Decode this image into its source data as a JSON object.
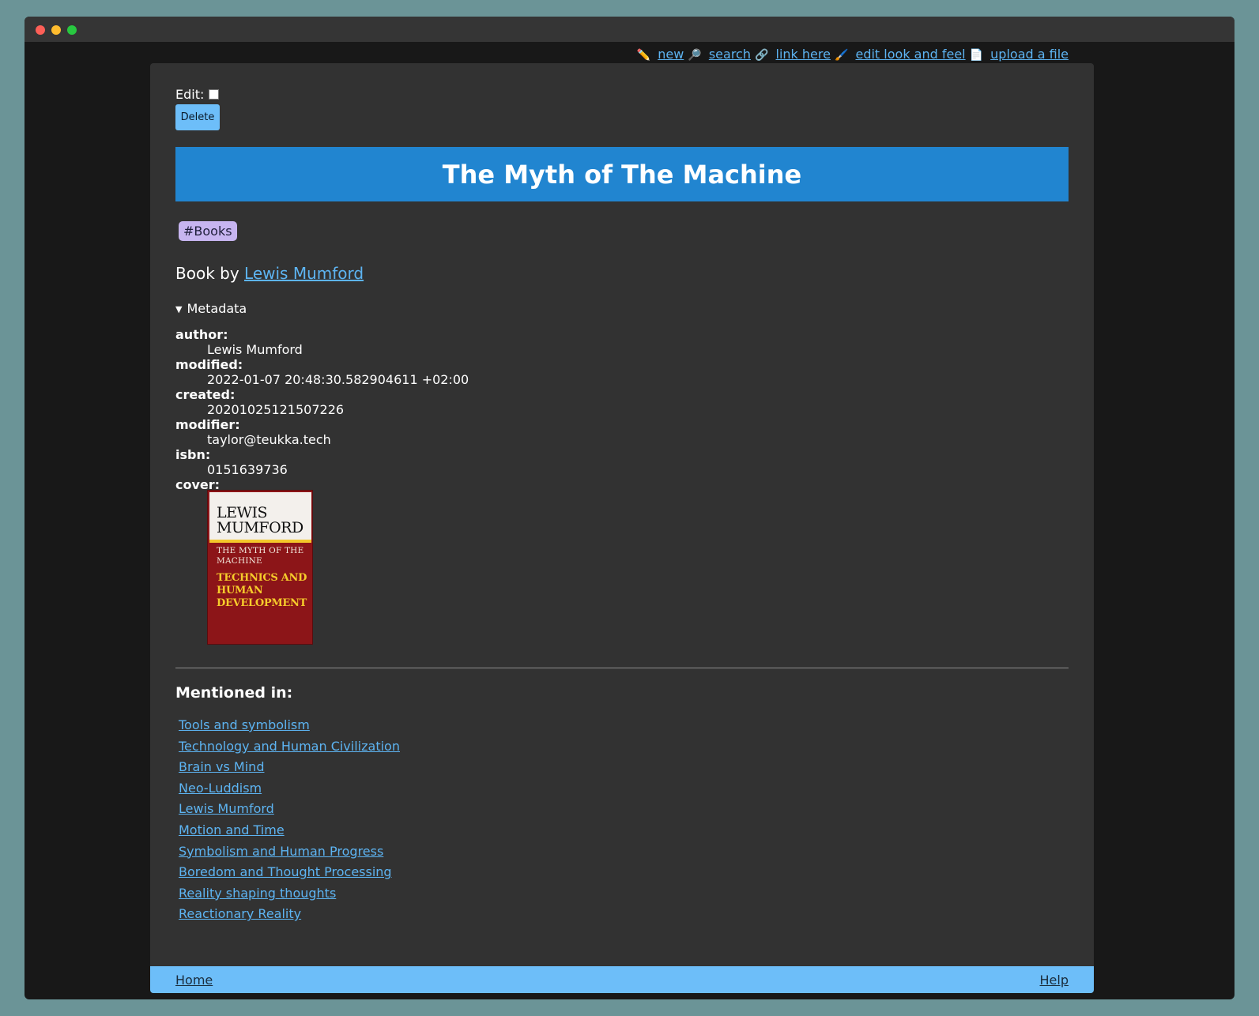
{
  "window": {
    "controls": [
      "close",
      "minimize",
      "maximize"
    ]
  },
  "topnav": {
    "items": [
      {
        "icon": "pencil-icon",
        "glyph": "✏️",
        "label": "new"
      },
      {
        "icon": "magnifier-icon",
        "glyph": "🔎",
        "label": "search"
      },
      {
        "icon": "link-icon",
        "glyph": "🔗",
        "label": "link here"
      },
      {
        "icon": "brush-icon",
        "glyph": "🖌️",
        "label": "edit look and feel"
      },
      {
        "icon": "file-icon",
        "glyph": "📄",
        "label": "upload a file"
      }
    ]
  },
  "edit": {
    "label": "Edit:",
    "checked": false,
    "delete_label": "Delete"
  },
  "page": {
    "title": "The Myth of The Machine",
    "tag": "#Books",
    "byline_prefix": "Book by",
    "byline_link": "Lewis Mumford",
    "metadata_summary": "Metadata"
  },
  "metadata": [
    {
      "key": "author:",
      "value": "Lewis Mumford"
    },
    {
      "key": "modified:",
      "value": "2022-01-07 20:48:30.582904611 +02:00"
    },
    {
      "key": "created:",
      "value": "20201025121507226"
    },
    {
      "key": "modifier:",
      "value": "taylor@teukka.tech"
    },
    {
      "key": "isbn:",
      "value": "0151639736"
    },
    {
      "key": "cover:",
      "value": ""
    }
  ],
  "cover": {
    "author": "LEWIS MUMFORD",
    "series": "THE MYTH OF THE MACHINE",
    "subtitle": "TECHNICS AND HUMAN DEVELOPMENT"
  },
  "mentioned": {
    "heading": "Mentioned in:",
    "items": [
      "Tools and symbolism",
      "Technology and Human Civilization",
      "Brain vs Mind",
      "Neo-Luddism",
      "Lewis Mumford",
      "Motion and Time",
      "Symbolism and Human Progress",
      "Boredom and Thought Processing",
      "Reality shaping thoughts",
      "Reactionary Reality"
    ]
  },
  "footer": {
    "home": "Home",
    "help": "Help"
  },
  "colors": {
    "background": "#6b9497",
    "window": "#181818",
    "page": "#323232",
    "banner": "#2185d0",
    "link": "#5db4f2",
    "footer": "#6dbef9",
    "tag": "#c7b5f0"
  }
}
